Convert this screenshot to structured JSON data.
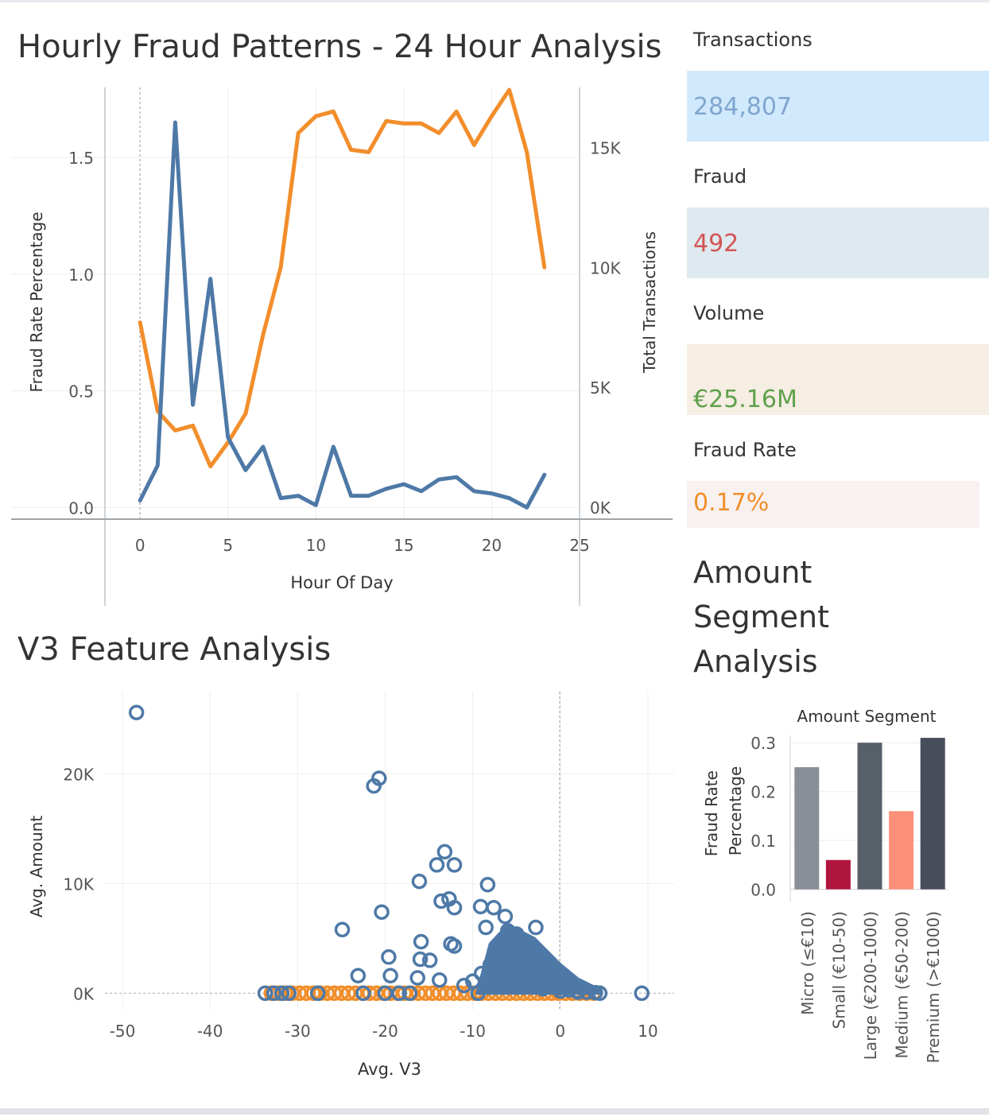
{
  "dashboard": {
    "hourly_title": "Hourly Fraud Patterns - 24 Hour Analysis",
    "v3_title": "V3 Feature Analysis",
    "segment_title": "Amount Segment Analysis"
  },
  "kpis": [
    {
      "label": "Transactions",
      "value": "284,807",
      "color": "#7fa6cf",
      "bg": "#d1e9fc"
    },
    {
      "label": "Fraud",
      "value": "492",
      "color": "#d45555",
      "bg": "#dfe9f0"
    },
    {
      "label": "Volume",
      "value": "€25.16M",
      "color": "#5ea14b",
      "bg": "#f6ede3"
    },
    {
      "label": "Fraud Rate",
      "value": "0.17%",
      "color": "#f28e2b",
      "bg": "#f8f1f0"
    }
  ],
  "colors": {
    "blue": "#4e79a7",
    "orange": "#f28e2b"
  },
  "chart_data": [
    {
      "type": "line",
      "title": "Hourly Fraud Patterns - 24 Hour Analysis",
      "xlabel": "Hour Of Day",
      "ylabel": "Fraud Rate Percentage",
      "y2label": "Total Transactions",
      "x": [
        0,
        1,
        2,
        3,
        4,
        5,
        6,
        7,
        8,
        9,
        10,
        11,
        12,
        13,
        14,
        15,
        16,
        17,
        18,
        19,
        20,
        21,
        22,
        23
      ],
      "xlim": [
        -2,
        25
      ],
      "xticks": [
        0,
        5,
        10,
        15,
        20,
        25
      ],
      "ylim": [
        -0.05,
        1.8
      ],
      "yticks": [
        0.0,
        0.5,
        1.0,
        1.5
      ],
      "y2lim": [
        -500,
        17500
      ],
      "y2ticks": [
        0,
        5000,
        10000,
        15000
      ],
      "y2ticklabels": [
        "0K",
        "5K",
        "10K",
        "15K"
      ],
      "grid": true,
      "series": [
        {
          "axis": "left",
          "color": "#4e79a7",
          "values": [
            0.03,
            0.18,
            1.65,
            0.44,
            0.98,
            0.3,
            0.16,
            0.26,
            0.04,
            0.05,
            0.01,
            0.26,
            0.05,
            0.05,
            0.08,
            0.1,
            0.07,
            0.12,
            0.13,
            0.07,
            0.06,
            0.04,
            0.0,
            0.14
          ]
        },
        {
          "axis": "right",
          "color": "#f28e2b",
          "values": [
            7700,
            4000,
            3200,
            3400,
            1700,
            2700,
            3900,
            7200,
            10000,
            15600,
            16300,
            16500,
            14900,
            14800,
            16100,
            16000,
            16000,
            15600,
            16500,
            15100,
            16300,
            17400,
            14800,
            10000
          ]
        }
      ]
    },
    {
      "type": "scatter",
      "title": "V3 Feature Analysis",
      "xlabel": "Avg. V3",
      "ylabel": "Avg. Amount",
      "xlim": [
        -52,
        13
      ],
      "xticks": [
        -50,
        -40,
        -30,
        -20,
        -10,
        0,
        10
      ],
      "ylim": [
        -1500,
        27500
      ],
      "yticks": [
        0,
        10000,
        20000
      ],
      "yticklabels": [
        "0K",
        "10K",
        "20K"
      ],
      "grid": true,
      "series": [
        {
          "name": "",
          "color": "#4e79a7",
          "points": [
            [
              -48.4,
              25600
            ],
            [
              -21.3,
              18900
            ],
            [
              -20.7,
              19600
            ],
            [
              -13.2,
              12900
            ],
            [
              -14.1,
              11700
            ],
            [
              -12.1,
              11700
            ],
            [
              -16.1,
              10200
            ],
            [
              -8.3,
              9900
            ],
            [
              -13.6,
              8400
            ],
            [
              -12.7,
              8600
            ],
            [
              -20.4,
              7400
            ],
            [
              -24.9,
              5800
            ],
            [
              -12.1,
              7800
            ],
            [
              -9.1,
              7900
            ],
            [
              -7.6,
              7800
            ],
            [
              -6.3,
              7000
            ],
            [
              -15.9,
              4700
            ],
            [
              -12.1,
              4300
            ],
            [
              -19.6,
              3300
            ],
            [
              -14.9,
              3000
            ],
            [
              -16.0,
              3100
            ],
            [
              -12.5,
              4500
            ],
            [
              -8.5,
              6000
            ],
            [
              -6.0,
              5700
            ],
            [
              -5.0,
              5400
            ],
            [
              -2.8,
              6000
            ],
            [
              -23.1,
              1600
            ],
            [
              -19.4,
              1600
            ],
            [
              -16.3,
              1400
            ],
            [
              -13.8,
              1200
            ],
            [
              -33.7,
              0
            ],
            [
              -32.7,
              0
            ],
            [
              -31.8,
              0
            ],
            [
              -31.0,
              0
            ],
            [
              -27.7,
              0
            ],
            [
              -22.5,
              0
            ],
            [
              -20.0,
              0
            ],
            [
              -18.4,
              0
            ],
            [
              -17.2,
              0
            ],
            [
              -9.4,
              0
            ],
            [
              9.3,
              0
            ],
            [
              -8,
              2600
            ],
            [
              -7,
              4100
            ],
            [
              -6,
              3300
            ],
            [
              -5,
              2600
            ],
            [
              -4,
              2000
            ],
            [
              -3,
              1500
            ],
            [
              -2,
              1100
            ],
            [
              -1,
              800
            ],
            [
              0,
              500
            ],
            [
              1,
              300
            ],
            [
              2,
              200
            ],
            [
              3,
              100
            ],
            [
              4,
              50
            ],
            [
              -9,
              1800
            ],
            [
              -10,
              1100
            ],
            [
              -11,
              700
            ],
            [
              -8,
              900
            ],
            [
              -7,
              1500
            ],
            [
              -6,
              800
            ],
            [
              -5,
              1300
            ],
            [
              -4,
              700
            ],
            [
              -3,
              900
            ],
            [
              -2,
              400
            ],
            [
              -1,
              600
            ],
            [
              0,
              200
            ],
            [
              2,
              100
            ],
            [
              4.5,
              0
            ]
          ]
        },
        {
          "name": "",
          "color": "#f28e2b",
          "points": [
            [
              -33.0,
              0
            ],
            [
              -32.2,
              0
            ],
            [
              -31.4,
              0
            ],
            [
              -30.6,
              0
            ],
            [
              -29.8,
              0
            ],
            [
              -29.0,
              0
            ],
            [
              -28.2,
              0
            ],
            [
              -27.4,
              0
            ],
            [
              -26.6,
              0
            ],
            [
              -25.8,
              0
            ],
            [
              -25.0,
              0
            ],
            [
              -24.2,
              0
            ],
            [
              -23.4,
              0
            ],
            [
              -22.6,
              0
            ],
            [
              -21.8,
              0
            ],
            [
              -21.0,
              0
            ],
            [
              -20.2,
              0
            ],
            [
              -19.4,
              0
            ],
            [
              -18.6,
              0
            ],
            [
              -17.8,
              0
            ],
            [
              -17.0,
              0
            ],
            [
              -16.2,
              0
            ],
            [
              -15.4,
              0
            ],
            [
              -14.6,
              0
            ],
            [
              -13.8,
              0
            ],
            [
              -13.0,
              0
            ],
            [
              -12.2,
              0
            ],
            [
              -11.4,
              0
            ],
            [
              -10.6,
              0
            ],
            [
              -9.8,
              0
            ],
            [
              -9.0,
              0
            ],
            [
              -8.2,
              0
            ],
            [
              -7.4,
              0
            ],
            [
              -6.6,
              0
            ],
            [
              -5.8,
              0
            ],
            [
              -5.0,
              0
            ],
            [
              -4.2,
              0
            ],
            [
              -3.4,
              0
            ],
            [
              -2.6,
              0
            ],
            [
              -1.8,
              0
            ],
            [
              -1.0,
              0
            ],
            [
              -0.2,
              0
            ],
            [
              0.6,
              0
            ],
            [
              1.4,
              0
            ],
            [
              2.2,
              0
            ],
            [
              3.0,
              0
            ],
            [
              3.8,
              0
            ]
          ]
        }
      ]
    },
    {
      "type": "bar",
      "title": "Amount Segment",
      "ylabel": "Fraud Rate Percentage",
      "categories": [
        "Micro (≤€10)",
        "Small (€10-50)",
        "Large (€200-1000)",
        "Medium (€50-200)",
        "Premium (>€1000)"
      ],
      "values": [
        0.25,
        0.06,
        0.3,
        0.16,
        0.31
      ],
      "colors": [
        "#898f96",
        "#b0153e",
        "#575f69",
        "#fc9078",
        "#474d5a"
      ],
      "ylim": [
        -0.025,
        0.315
      ],
      "yticks": [
        0.0,
        0.1,
        0.2,
        0.3
      ],
      "grid": true
    }
  ]
}
